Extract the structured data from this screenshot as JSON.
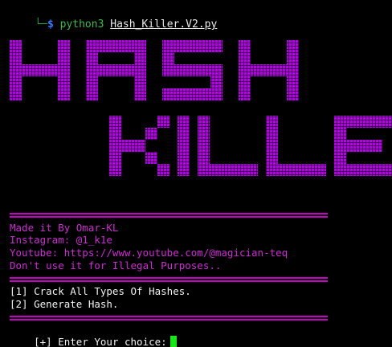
{
  "prompt": {
    "corner": "└─",
    "symbol": "$",
    "command": "python3",
    "argument": "Hash_Killer.V2.py"
  },
  "banner": {
    "line1": "HASH",
    "line2": "KILLER",
    "color": "#b400e6"
  },
  "info": {
    "author": "Made it By Omar-KL",
    "instagram": "Instagram: @1_k1e",
    "youtube": "Youtube: https://www.youtube.com/@magician-teq",
    "disclaimer": "Don't use it for Illegal Purposes.."
  },
  "menu": {
    "option1": "[1] Crack All Types Of Hashes.",
    "option2": "[2] Generate Hash."
  },
  "input": {
    "prompt": "[+] Enter Your choice:"
  },
  "colors": {
    "accent": "#cc2cd1",
    "cursor": "#19e619"
  }
}
